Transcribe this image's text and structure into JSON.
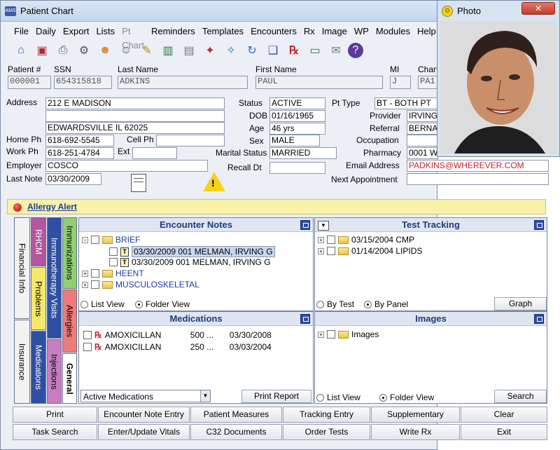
{
  "window": {
    "title": "Patient Chart"
  },
  "menu": [
    "File",
    "Daily",
    "Export",
    "Lists",
    "Pt Chart",
    "Reminders",
    "Templates",
    "Encounters",
    "Rx",
    "Image",
    "WP",
    "Modules",
    "Help"
  ],
  "toolbar_icons": [
    "home-icon",
    "save-icon",
    "printer-icon",
    "gear-icon",
    "patient-icon",
    "add-patient-icon",
    "notepad-icon",
    "chart-icon",
    "clipboard-icon",
    "pin-icon",
    "pushpin-icon",
    "refresh-icon",
    "book-icon",
    "rx-icon",
    "tray-icon",
    "mail-icon",
    "help-icon"
  ],
  "header": {
    "patient_no_label": "Patient #",
    "patient_no": "000001",
    "ssn_label": "SSN",
    "ssn": "654315818",
    "last_name_label": "Last Name",
    "last_name": "ADKINS",
    "first_name_label": "First Name",
    "first_name": "PAUL",
    "mi_label": "MI",
    "mi": "J",
    "chart_label": "Chart",
    "chart": "PA1"
  },
  "demographics": {
    "address_label": "Address",
    "address1": "212 E MADISON",
    "address2": "",
    "city": "EDWARDSVILLE  IL  62025",
    "home_ph_label": "Home Ph",
    "home_ph": "618-692-5545",
    "cell_ph_label": "Cell Ph",
    "cell_ph": "",
    "work_ph_label": "Work Ph",
    "work_ph": "618-251-4784",
    "ext_label": "Ext",
    "ext": "",
    "employer_label": "Employer",
    "employer": "COSCO",
    "last_note_label": "Last Note",
    "last_note": "03/30/2009",
    "status_label": "Status",
    "status": "ACTIVE",
    "pt_type_label": "Pt Type",
    "pt_type": "BT - BOTH PT",
    "dob_label": "DOB",
    "dob": "01/16/1965",
    "provider_label": "Provider",
    "provider": "IRVING",
    "age_label": "Age",
    "age": "46 yrs",
    "referral_label": "Referral",
    "referral": "BERNAR",
    "sex_label": "Sex",
    "sex": "MALE",
    "occupation_label": "Occupation",
    "occupation": "",
    "marital_label": "Marital Status",
    "marital": "MARRIED",
    "pharmacy_label": "Pharmacy",
    "pharmacy": "0001 W",
    "recall_label": "Recall Dt",
    "recall": "",
    "email_label": "Email Address",
    "email": "PADKINS@WHEREVER.COM",
    "next_appt_label": "Next Appointment",
    "next_appt": ""
  },
  "alert": {
    "text": "Allergy Alert"
  },
  "side_tabs": [
    "Financial Info",
    "Insurance",
    "RHCM",
    "Problems",
    "Immunotherapy Visits",
    "Medications",
    "Immunizations",
    "Injections",
    "Allergies",
    "General"
  ],
  "encounter_notes": {
    "title": "Encounter Notes",
    "items": [
      {
        "label": "BRIEF",
        "type": "folder",
        "expand": "−"
      },
      {
        "label": "03/30/2009  001 MELMAN, IRVING G",
        "type": "note",
        "selected": true
      },
      {
        "label": "03/30/2009  001 MELMAN, IRVING G",
        "type": "note"
      },
      {
        "label": "HEENT",
        "type": "folder",
        "expand": "+"
      },
      {
        "label": "MUSCULOSKELETAL",
        "type": "folder",
        "expand": "+"
      }
    ],
    "list_view": "List View",
    "folder_view": "Folder View"
  },
  "test_tracking": {
    "title": "Test Tracking",
    "items": [
      {
        "label": "03/15/2004 CMP"
      },
      {
        "label": "01/14/2004 LIPIDS"
      }
    ],
    "by_test": "By Test",
    "by_panel": "By Panel",
    "graph": "Graph"
  },
  "medications": {
    "title": "Medications",
    "items": [
      {
        "name": "AMOXICILLAN",
        "dose": "500 ...",
        "date": "03/30/2008"
      },
      {
        "name": "AMOXICILLAN",
        "dose": "250 ...",
        "date": "03/03/2004"
      }
    ],
    "filter": "Active Medications",
    "print_report": "Print Report"
  },
  "images": {
    "title": "Images",
    "items": [
      {
        "label": "Images"
      }
    ],
    "list_view": "List View",
    "folder_view": "Folder View",
    "search": "Search"
  },
  "buttons_row1": [
    "Print",
    "Encounter Note Entry",
    "Patient Measures",
    "Tracking Entry",
    "Supplementary",
    "Clear"
  ],
  "buttons_row2": [
    "Task Search",
    "Enter/Update Vitals",
    "C32 Documents",
    "Order Tests",
    "Write Rx",
    "Exit"
  ],
  "photo": {
    "title": "Photo",
    "close": "✕"
  }
}
